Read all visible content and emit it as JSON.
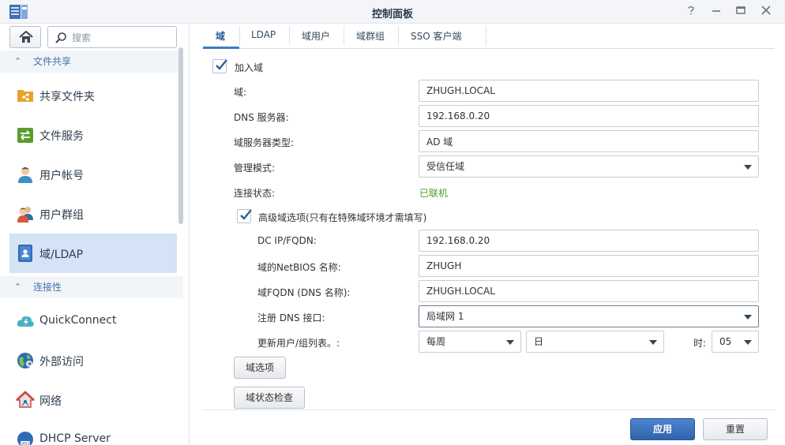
{
  "window": {
    "title": "控制面板",
    "controls": [
      "help-icon",
      "minimize-icon",
      "maximize-icon",
      "close-icon"
    ]
  },
  "sidebar": {
    "search_placeholder": "搜索",
    "sections": [
      {
        "title": "文件共享",
        "items": [
          {
            "label": "共享文件夹",
            "icon": "shared-folder-icon"
          },
          {
            "label": "文件服务",
            "icon": "file-services-icon"
          },
          {
            "label": "用户帐号",
            "icon": "user-icon"
          },
          {
            "label": "用户群组",
            "icon": "user-group-icon"
          },
          {
            "label": "域/LDAP",
            "icon": "domain-ldap-icon",
            "active": true
          }
        ]
      },
      {
        "title": "连接性",
        "items": [
          {
            "label": "QuickConnect",
            "icon": "quickconnect-icon"
          },
          {
            "label": "外部访问",
            "icon": "external-access-icon"
          },
          {
            "label": "网络",
            "icon": "network-icon"
          },
          {
            "label": "DHCP Server",
            "icon": "dhcp-server-icon"
          }
        ]
      }
    ]
  },
  "tabs": [
    {
      "label": "域",
      "active": true
    },
    {
      "label": "LDAP"
    },
    {
      "label": "域用户"
    },
    {
      "label": "域群组"
    },
    {
      "label": "SSO 客户端"
    }
  ],
  "form": {
    "join_domain_label": "加入域",
    "join_domain_checked": true,
    "domain_label": "域:",
    "domain_value": "ZHUGH.LOCAL",
    "dns_label": "DNS 服务器:",
    "dns_value": "192.168.0.20",
    "server_type_label": "域服务器类型:",
    "server_type_value": "AD 域",
    "mgmt_mode_label": "管理模式:",
    "mgmt_mode_value": "受信任域",
    "conn_status_label": "连接状态:",
    "conn_status_value": "已联机",
    "advanced_label": "高级域选项(只有在特殊域环境才需填写)",
    "advanced_checked": true,
    "dc_label": "DC IP/FQDN:",
    "dc_value": "192.168.0.20",
    "netbios_label": "域的NetBIOS 名称:",
    "netbios_value": "ZHUGH",
    "fqdn_label": "域FQDN (DNS 名称):",
    "fqdn_value": "ZHUGH.LOCAL",
    "register_dns_label": "注册 DNS 接口:",
    "register_dns_value": "局域网 1",
    "update_label": "更新用户/组列表。:",
    "update_freq_value": "每周",
    "update_day_value": "日",
    "hour_label": "时:",
    "hour_value": "05",
    "domain_options_button": "域选项",
    "status_check_button": "域状态检查"
  },
  "footer": {
    "apply_button": "应用",
    "reset_button": "重置"
  },
  "colors": {
    "accent": "#3a7bc8",
    "active_nav": "#d4e3f6",
    "status_ok": "#4d9a2a",
    "primary_button": "#3b6fbe"
  }
}
